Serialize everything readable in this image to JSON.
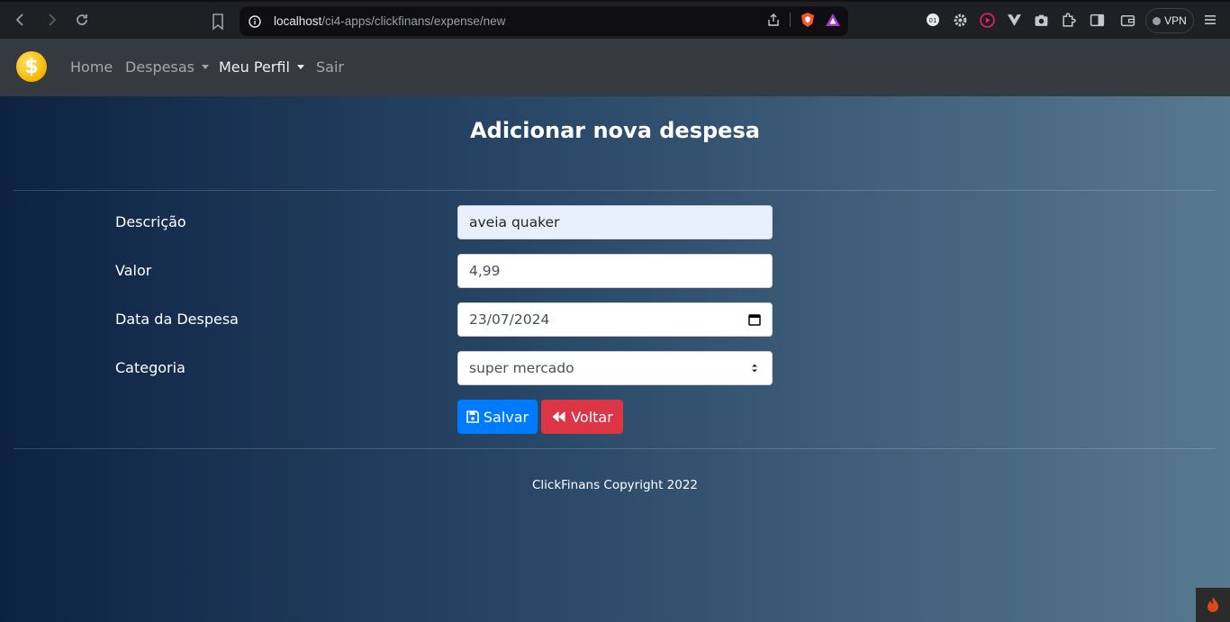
{
  "browser": {
    "url_host": "localhost",
    "url_path": "/ci4-apps/clickfinans/expense/new",
    "vpn_label": "VPN"
  },
  "navbar": {
    "brand_symbol": "$",
    "items": [
      {
        "label": "Home"
      },
      {
        "label": "Despesas"
      },
      {
        "label": "Meu Perfil"
      },
      {
        "label": "Sair"
      }
    ]
  },
  "page": {
    "title": "Adicionar nova despesa"
  },
  "form": {
    "descricao": {
      "label": "Descrição",
      "value": "aveia quaker"
    },
    "valor": {
      "label": "Valor",
      "value": "4,99"
    },
    "data": {
      "label": "Data da Despesa",
      "value": "23/07/2024"
    },
    "categoria": {
      "label": "Categoria",
      "value": "super mercado"
    },
    "save_label": "Salvar",
    "back_label": "Voltar"
  },
  "footer": {
    "text": "ClickFinans Copyright 2022"
  },
  "colors": {
    "primary": "#007bff",
    "danger": "#dc3545",
    "navbar": "#343a40"
  }
}
